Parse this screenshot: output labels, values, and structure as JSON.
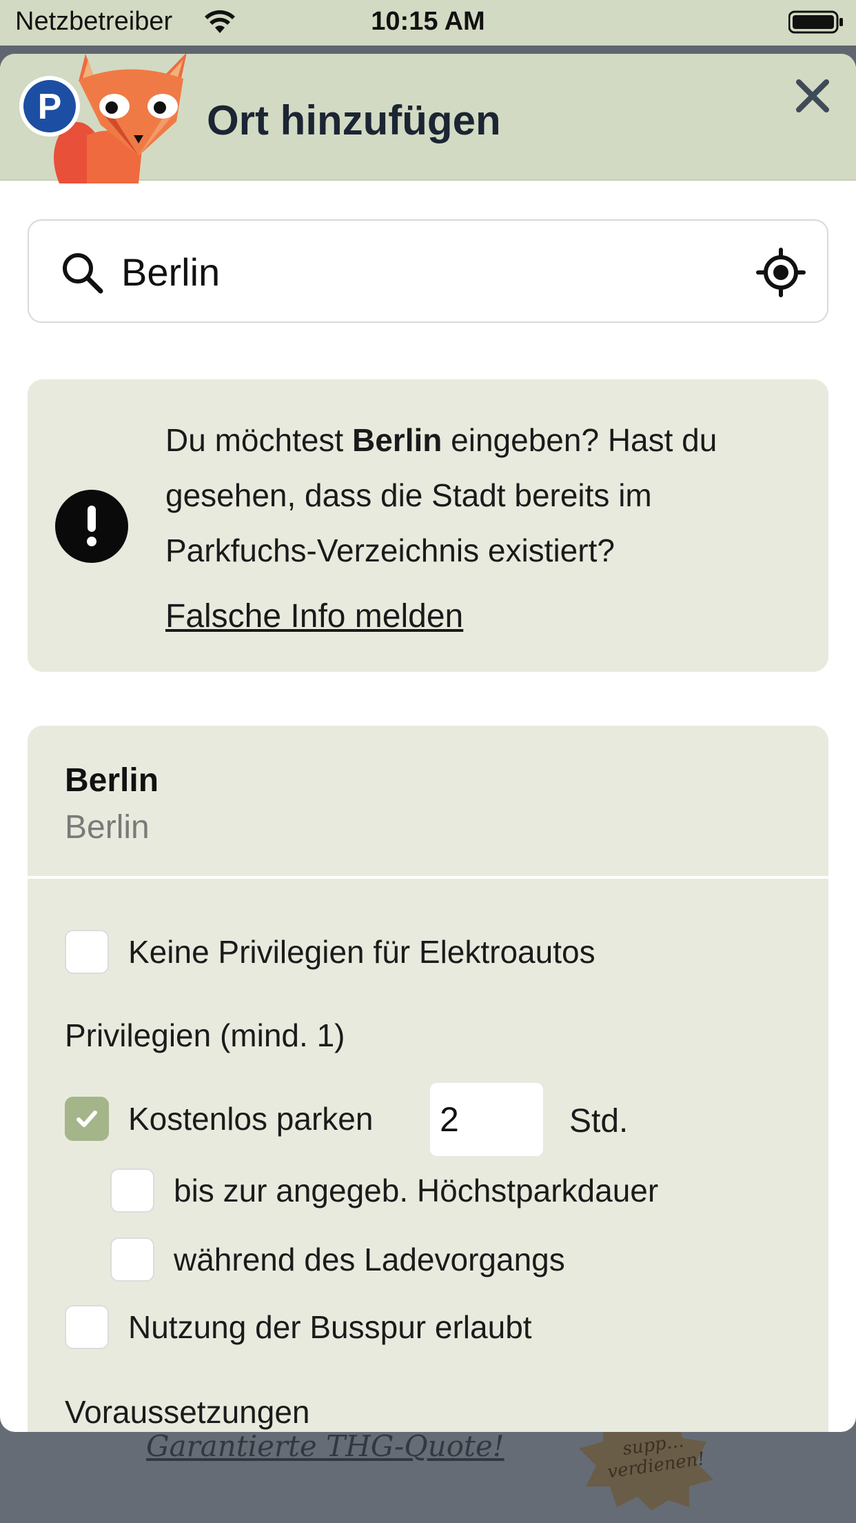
{
  "status_bar": {
    "carrier": "Netzbetreiber",
    "time": "10:15 AM"
  },
  "background": {
    "link_text": "Garantierte THG-Quote!",
    "badge_text": "supp… verdienen!"
  },
  "header": {
    "title": "Ort hinzufügen",
    "logo_letter": "P"
  },
  "search": {
    "value": "Berlin",
    "placeholder": ""
  },
  "warning": {
    "text_before": "Du möchtest ",
    "text_bold": "Berlin",
    "text_after": " eingeben? Hast du gesehen, dass die Stadt bereits im Parkfuchs-Verzeichnis existiert?",
    "link": "Falsche Info melden"
  },
  "location": {
    "name": "Berlin",
    "region": "Berlin",
    "options": {
      "no_privileges": {
        "label": "Keine Privilegien für Elektroautos",
        "checked": false
      },
      "privileges_heading": "Privilegien (mind. 1)",
      "free_parking": {
        "label": "Kostenlos parken",
        "checked": true,
        "hours": "2",
        "unit": "Std."
      },
      "until_max": {
        "label": "bis zur angegeb. Höchstparkdauer",
        "checked": false
      },
      "while_charging": {
        "label": "während des Ladevorgangs",
        "checked": false
      },
      "bus_lane": {
        "label": "Nutzung der Busspur erlaubt",
        "checked": false
      },
      "requirements_heading": "Voraussetzungen"
    }
  },
  "colors": {
    "header_bg": "#d2dac3",
    "card_bg": "#e8eade",
    "checked": "#a4b58a",
    "title": "#1c2533"
  }
}
